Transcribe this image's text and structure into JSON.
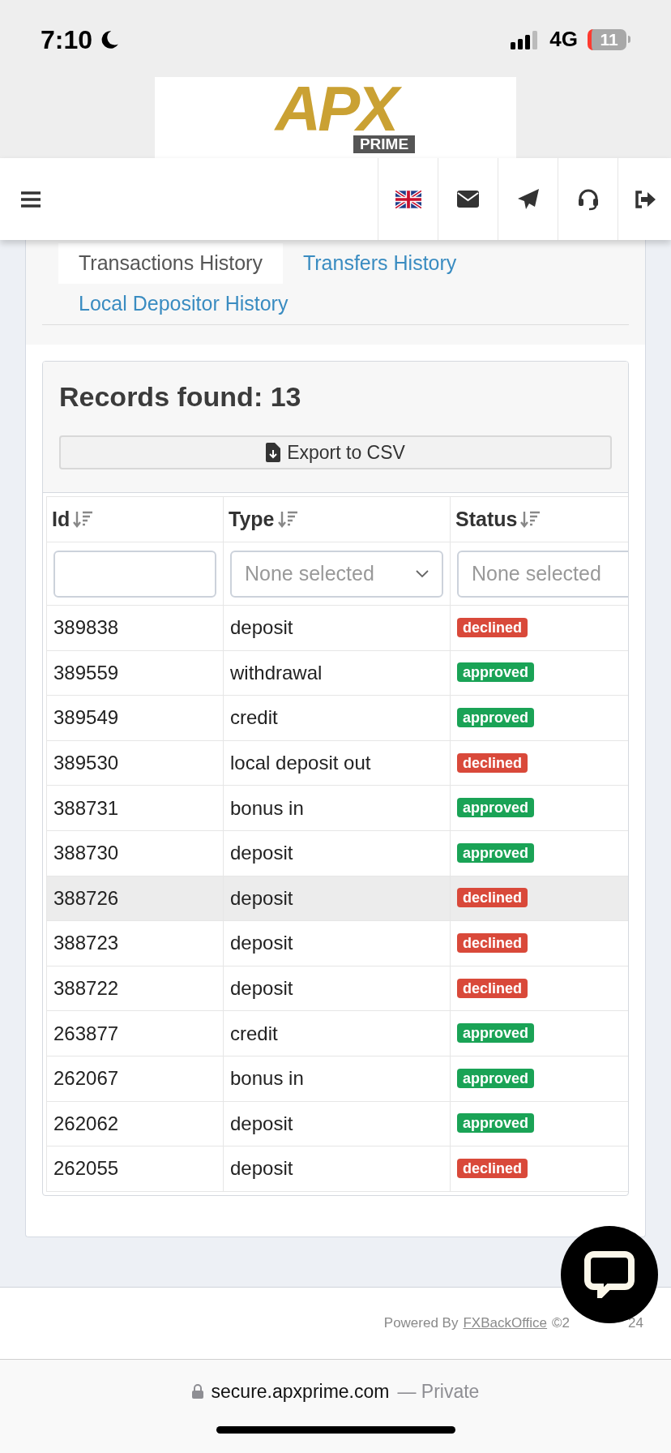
{
  "status_bar": {
    "time": "7:10",
    "network": "4G",
    "battery": "11"
  },
  "logo": {
    "main": "APX",
    "sub": "PRIME"
  },
  "tabs": [
    {
      "label": "Transactions History",
      "selected": true
    },
    {
      "label": "Transfers History",
      "selected": false
    },
    {
      "label": "Local Depositor History",
      "selected": false
    }
  ],
  "records": {
    "title": "Records found: 13",
    "export_button": "Export to CSV"
  },
  "table": {
    "columns": [
      "Id",
      "Type",
      "Status"
    ],
    "filters": [
      {
        "kind": "text"
      },
      {
        "kind": "select",
        "placeholder": "None selected"
      },
      {
        "kind": "select",
        "placeholder": "None selected"
      }
    ],
    "rows": [
      {
        "id": "389838",
        "type": "deposit",
        "status": "declined",
        "kind": "declined",
        "highlighted": false
      },
      {
        "id": "389559",
        "type": "withdrawal",
        "status": "approved",
        "kind": "approved",
        "highlighted": false
      },
      {
        "id": "389549",
        "type": "credit",
        "status": "approved",
        "kind": "approved",
        "highlighted": false
      },
      {
        "id": "389530",
        "type": "local deposit out",
        "status": "declined",
        "kind": "declined",
        "highlighted": false
      },
      {
        "id": "388731",
        "type": "bonus in",
        "status": "approved",
        "kind": "approved",
        "highlighted": false
      },
      {
        "id": "388730",
        "type": "deposit",
        "status": "approved",
        "kind": "approved",
        "highlighted": false
      },
      {
        "id": "388726",
        "type": "deposit",
        "status": "declined",
        "kind": "declined",
        "highlighted": true
      },
      {
        "id": "388723",
        "type": "deposit",
        "status": "declined",
        "kind": "declined",
        "highlighted": false
      },
      {
        "id": "388722",
        "type": "deposit",
        "status": "declined",
        "kind": "declined",
        "highlighted": false
      },
      {
        "id": "263877",
        "type": "credit",
        "status": "approved",
        "kind": "approved",
        "highlighted": false
      },
      {
        "id": "262067",
        "type": "bonus in",
        "status": "approved",
        "kind": "approved",
        "highlighted": false
      },
      {
        "id": "262062",
        "type": "deposit",
        "status": "approved",
        "kind": "approved",
        "highlighted": false
      },
      {
        "id": "262055",
        "type": "deposit",
        "status": "declined",
        "kind": "declined",
        "highlighted": false
      }
    ]
  },
  "footer": {
    "prefix": "Powered By",
    "link": "FXBackOffice",
    "copyright_start": "©2",
    "copyright_end": "24"
  },
  "browser": {
    "domain": "secure.apxprime.com",
    "mode": "— Private"
  }
}
